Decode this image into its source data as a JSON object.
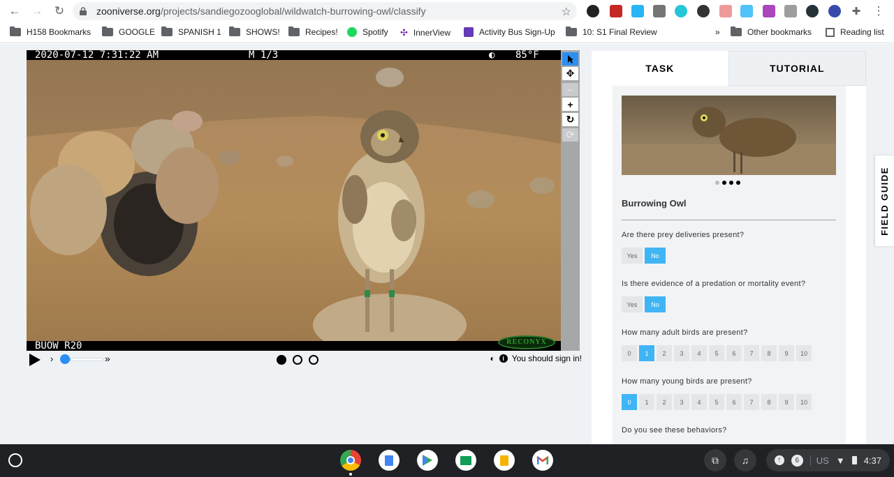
{
  "browser": {
    "url_host": "zooniverse.org",
    "url_path": "/projects/sandiegozooglobal/wildwatch-burrowing-owl/classify"
  },
  "bookmarks": [
    {
      "label": "H158 Bookmarks"
    },
    {
      "label": "GOOGLE"
    },
    {
      "label": "SPANISH 1"
    },
    {
      "label": "SHOWS!"
    },
    {
      "label": "Recipes!"
    },
    {
      "label": "Spotify"
    },
    {
      "label": "InnerView"
    },
    {
      "label": "Activity Bus Sign-Up"
    },
    {
      "label": "10: S1 Final Review"
    }
  ],
  "bookmarks_overflow": "»",
  "other_bookmarks": "Other bookmarks",
  "reading_list": "Reading list",
  "camera": {
    "timestamp": "2020-07-12  7:31:22 AM",
    "frame": "M 1/3",
    "temperature": "85°F",
    "camera_id": "BUOW R20",
    "brand": "RECONYX"
  },
  "viewer": {
    "signin_text": "You should sign in!",
    "frames_total": 3,
    "frame_current": 1
  },
  "panel": {
    "tab_task": "TASK",
    "tab_tutorial": "TUTORIAL",
    "species_name": "Burrowing Owl",
    "carousel_total": 4,
    "carousel_current": 1,
    "questions": [
      {
        "text": "Are there prey deliveries present?",
        "options": [
          "Yes",
          "No"
        ],
        "selected": "No"
      },
      {
        "text": "Is there evidence of a predation or mortality event?",
        "options": [
          "Yes",
          "No"
        ],
        "selected": "No"
      },
      {
        "text": "How many adult birds are present?",
        "options": [
          "0",
          "1",
          "2",
          "3",
          "4",
          "5",
          "6",
          "7",
          "8",
          "9",
          "10"
        ],
        "selected": "1"
      },
      {
        "text": "How many young birds are present?",
        "options": [
          "0",
          "1",
          "2",
          "3",
          "4",
          "5",
          "6",
          "7",
          "8",
          "9",
          "10"
        ],
        "selected": "0"
      },
      {
        "text": "Do you see these behaviors?"
      }
    ]
  },
  "field_guide": "FIELD GUIDE",
  "shelf": {
    "notification_count": "6",
    "locale": "US",
    "time": "4:37"
  },
  "colors": {
    "accent": "#40b5f5",
    "tool_active": "#2b8ff2",
    "shelf_bg": "#1f2124"
  }
}
